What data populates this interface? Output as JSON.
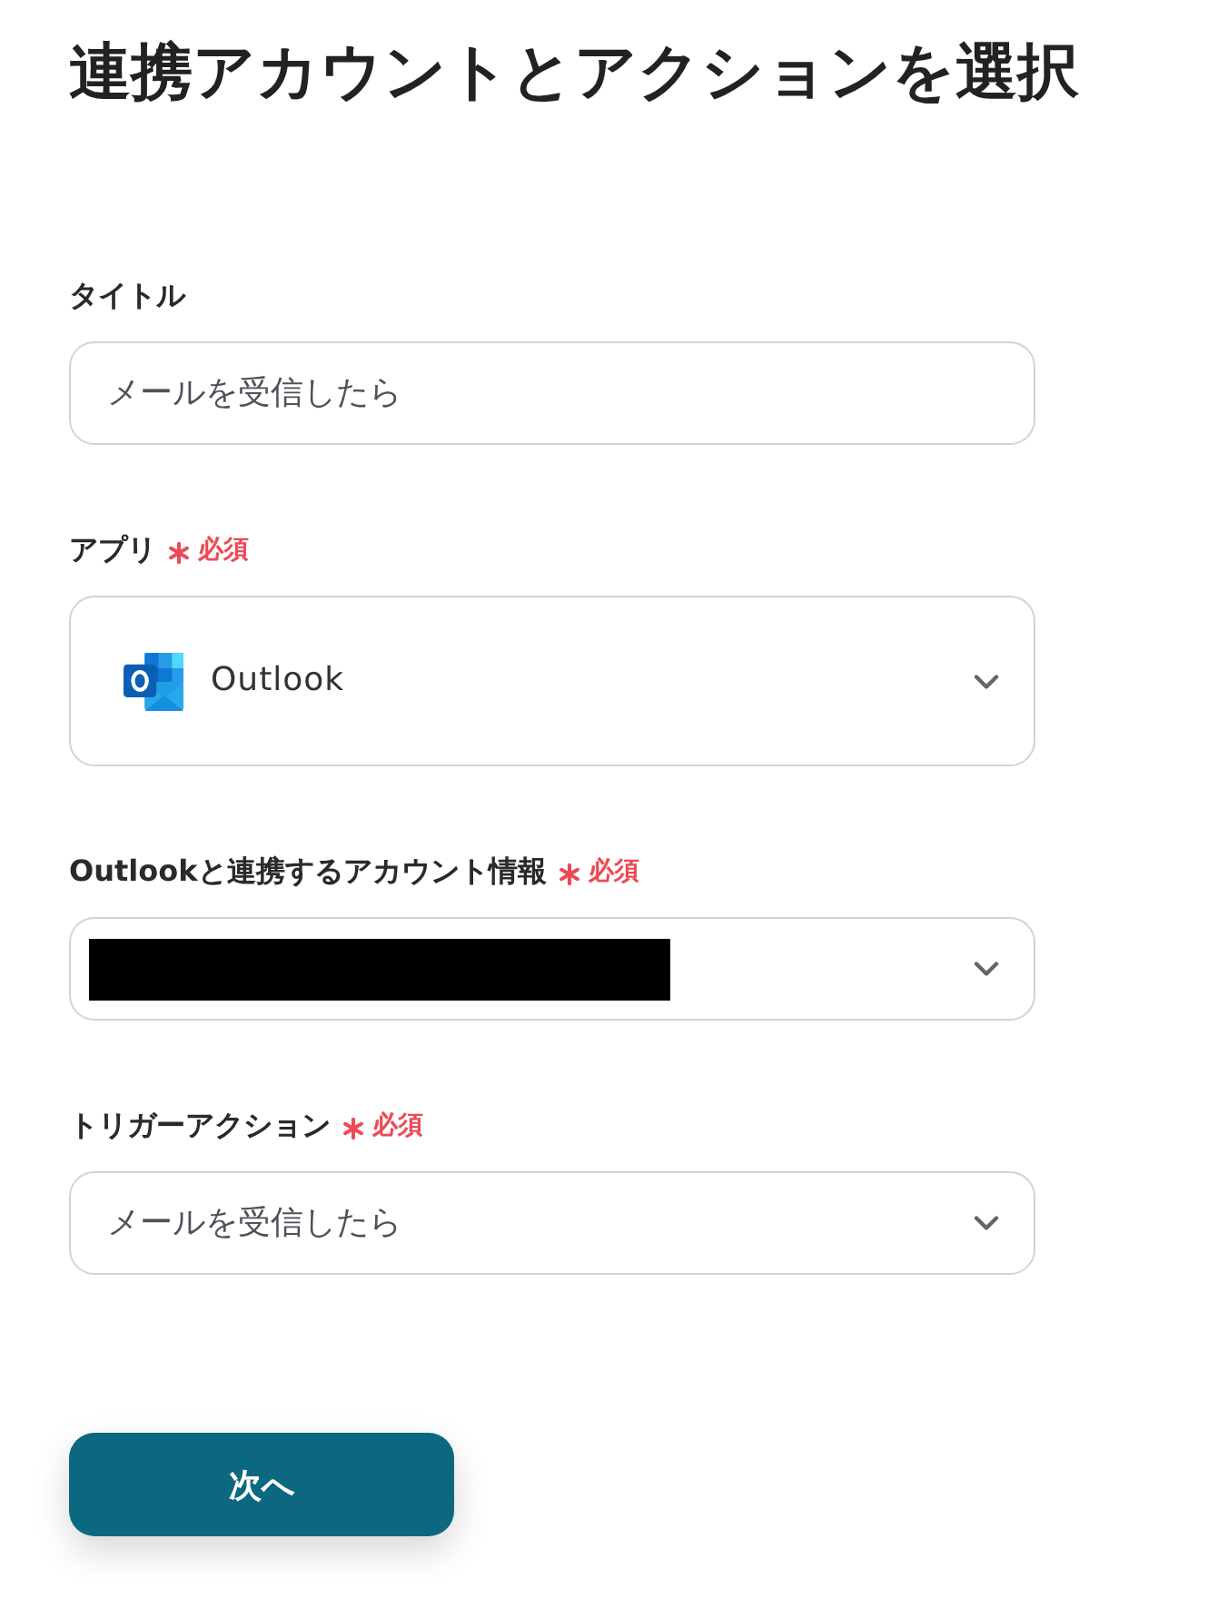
{
  "heading": "連携アカウントとアクションを選択",
  "fields": [
    {
      "kind": "text",
      "label": "タイトル",
      "required": false,
      "value": "メールを受信したら"
    },
    {
      "kind": "app",
      "label": "アプリ",
      "required": true,
      "required_label": "必須",
      "value": "Outlook"
    },
    {
      "kind": "select",
      "label": "Outlookと連携するアカウント情報",
      "required": true,
      "required_label": "必須",
      "redacted": true
    },
    {
      "kind": "select",
      "label": "トリガーアクション",
      "required": true,
      "required_label": "必須",
      "value": "メールを受信したら"
    }
  ],
  "next_button": {
    "label": "次へ"
  }
}
